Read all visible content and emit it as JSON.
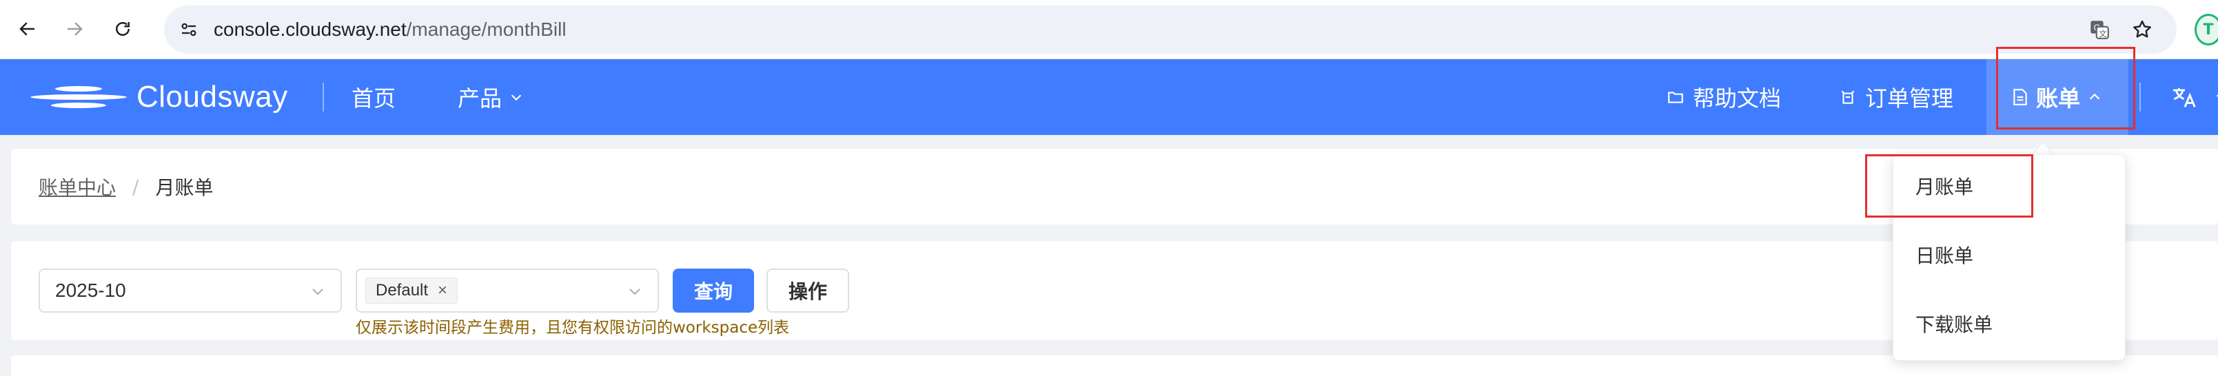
{
  "browser": {
    "url_host": "console.cloudsway.net",
    "url_path": "/manage/monthBill",
    "extension_badge": "T"
  },
  "header": {
    "logo_text": "Cloudsway",
    "nav_home": "首页",
    "nav_products": "产品",
    "nav_docs": "帮助文档",
    "nav_orders": "订单管理",
    "nav_bills": "账单",
    "accent_color": "#3f7cff"
  },
  "breadcrumb": {
    "parent": "账单中心",
    "separator": "/",
    "current": "月账单"
  },
  "filters": {
    "month_value": "2025-10",
    "workspace_tag": "Default",
    "tag_close": "×",
    "query_button": "查询",
    "action_button": "操作",
    "hint": "仅展示该时间段产生费用，且您有权限访问的workspace列表"
  },
  "bills_menu": {
    "items": [
      "月账单",
      "日账单",
      "下载账单"
    ]
  },
  "highlight_color": "#e62e2e"
}
